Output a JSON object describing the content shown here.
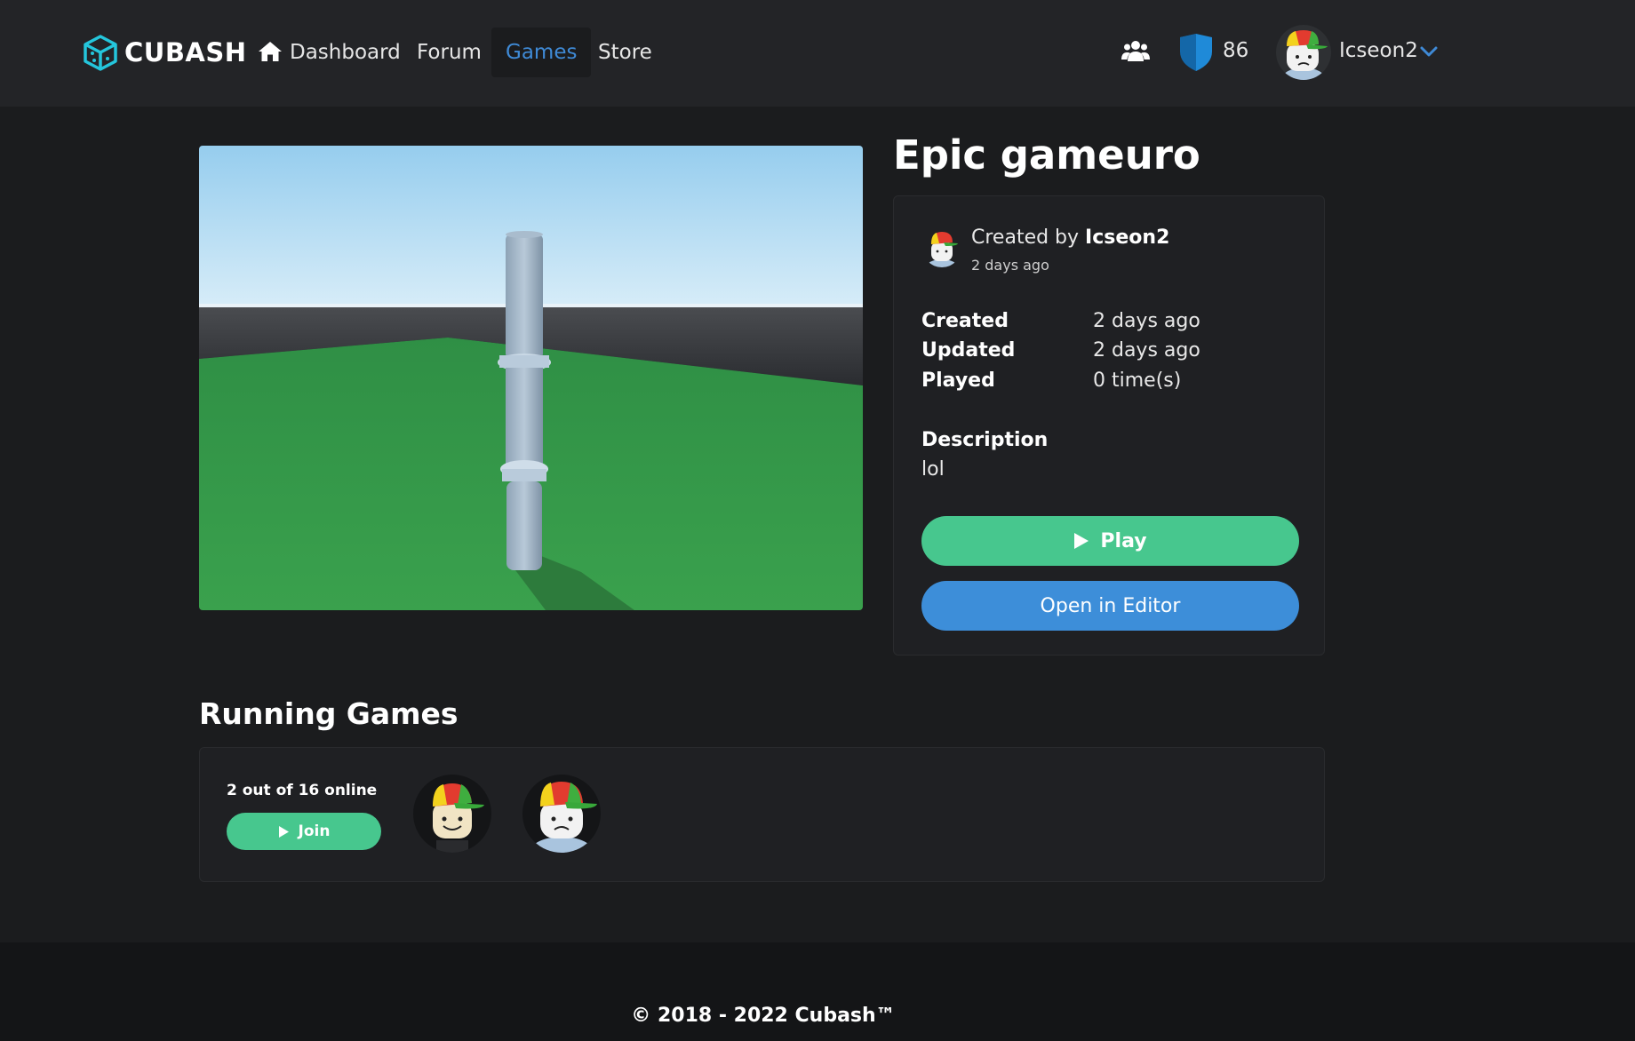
{
  "brand": {
    "name": "CUBASH",
    "accent": "#24c6dc"
  },
  "nav": {
    "links": [
      {
        "label": "Dashboard"
      },
      {
        "label": "Forum"
      },
      {
        "label": "Games"
      },
      {
        "label": "Store"
      }
    ],
    "active": "Games",
    "currency_amount": "86",
    "username": "Icseon2"
  },
  "game": {
    "title": "Epic gameuro",
    "creator_prefix": "Created by ",
    "creator_name": "Icseon2",
    "creator_ago": "2 days ago",
    "stats": [
      {
        "label": "Created",
        "value": "2 days ago"
      },
      {
        "label": "Updated",
        "value": "2 days ago"
      },
      {
        "label": "Played",
        "value": "0 time(s)"
      }
    ],
    "description_label": "Description",
    "description": "lol",
    "play_label": "Play",
    "editor_label": "Open in Editor"
  },
  "running": {
    "title": "Running Games",
    "servers": [
      {
        "online_text": "2 out of 16 online",
        "join_label": "Join"
      }
    ]
  },
  "footer": {
    "copyright": "© 2018 - 2022 Cubash™"
  },
  "colors": {
    "background": "#1b1c1e",
    "nav": "#232427",
    "play_green": "#47c78e",
    "editor_blue": "#3d8ed9",
    "active_link": "#3f8ad6"
  }
}
